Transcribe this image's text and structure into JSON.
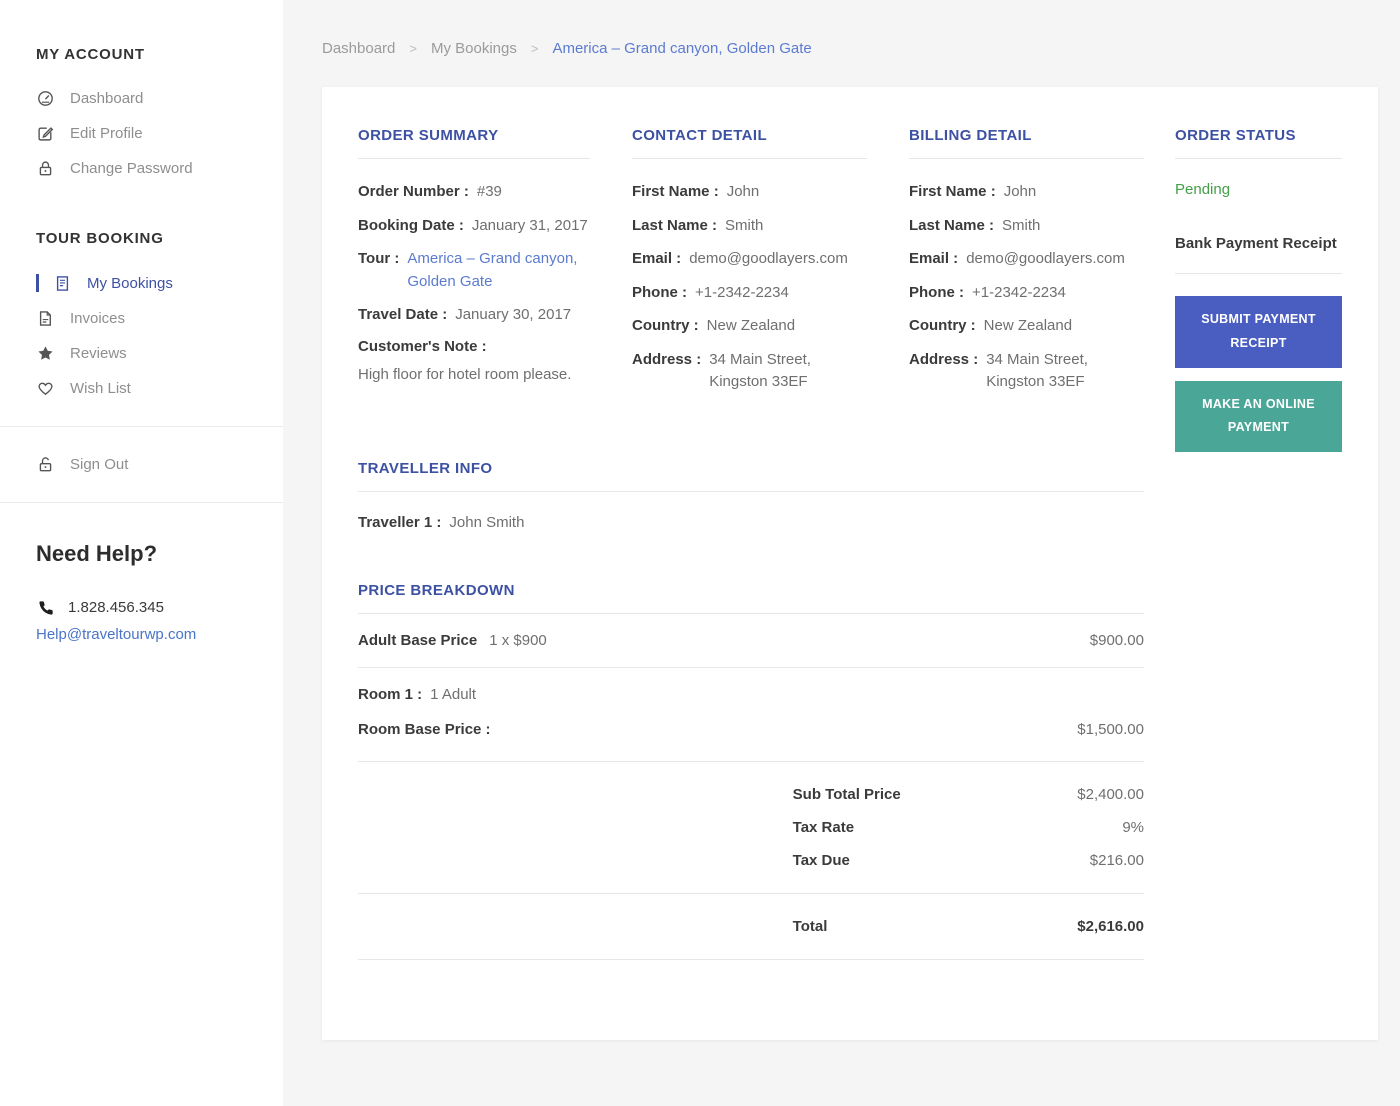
{
  "colors": {
    "heading_blue": "#3d51a3",
    "link_blue": "#5b7bd0",
    "pending_green": "#43a047",
    "button_primary": "#4a5ec2",
    "button_secondary": "#4aa696"
  },
  "sidebar": {
    "sections": [
      {
        "title": "MY ACCOUNT",
        "items": [
          {
            "label": "Dashboard",
            "icon": "dashboard-icon"
          },
          {
            "label": "Edit Profile",
            "icon": "edit-icon"
          },
          {
            "label": "Change Password",
            "icon": "lock-icon"
          }
        ]
      },
      {
        "title": "TOUR BOOKING",
        "items": [
          {
            "label": "My Bookings",
            "icon": "bookings-icon",
            "active": true
          },
          {
            "label": "Invoices",
            "icon": "invoice-icon"
          },
          {
            "label": "Reviews",
            "icon": "star-icon"
          },
          {
            "label": "Wish List",
            "icon": "heart-icon"
          }
        ]
      }
    ],
    "sign_out": {
      "label": "Sign Out",
      "icon": "unlock-icon"
    },
    "help": {
      "title": "Need Help?",
      "phone": "1.828.456.345",
      "email": "Help@traveltourwp.com"
    }
  },
  "breadcrumb": {
    "items": [
      "Dashboard",
      "My Bookings",
      "America – Grand canyon, Golden Gate"
    ],
    "separator": ">"
  },
  "order_summary": {
    "title": "ORDER SUMMARY",
    "rows": [
      {
        "label": "Order Number :",
        "value": "#39"
      },
      {
        "label": "Booking Date :",
        "value": "January 31, 2017"
      },
      {
        "label": "Tour :",
        "value": "America – Grand canyon, Golden Gate"
      },
      {
        "label": "Travel Date :",
        "value": "January 30, 2017"
      }
    ],
    "note_label": "Customer's Note :",
    "note": "High floor for hotel room please."
  },
  "contact_detail": {
    "title": "CONTACT DETAIL",
    "rows": [
      {
        "label": "First Name :",
        "value": "John"
      },
      {
        "label": "Last Name :",
        "value": "Smith"
      },
      {
        "label": "Email :",
        "value": "demo@goodlayers.com"
      },
      {
        "label": "Phone :",
        "value": "+1-2342-2234"
      },
      {
        "label": "Country :",
        "value": "New Zealand"
      },
      {
        "label": "Address :",
        "value": "34 Main Street, Kingston 33EF"
      }
    ]
  },
  "billing_detail": {
    "title": "BILLING DETAIL",
    "rows": [
      {
        "label": "First Name :",
        "value": "John"
      },
      {
        "label": "Last Name :",
        "value": "Smith"
      },
      {
        "label": "Email :",
        "value": "demo@goodlayers.com"
      },
      {
        "label": "Phone :",
        "value": "+1-2342-2234"
      },
      {
        "label": "Country :",
        "value": "New Zealand"
      },
      {
        "label": "Address :",
        "value": "34 Main Street, Kingston 33EF"
      }
    ]
  },
  "order_status": {
    "title": "ORDER STATUS",
    "status": "Pending",
    "receipt_label": "Bank Payment Receipt",
    "buttons": [
      {
        "label": "SUBMIT PAYMENT RECEIPT"
      },
      {
        "label": "MAKE AN ONLINE PAYMENT"
      }
    ]
  },
  "traveller_info": {
    "title": "TRAVELLER INFO",
    "rows": [
      {
        "label": "Traveller 1 :",
        "value": "John Smith"
      }
    ]
  },
  "price_breakdown": {
    "title": "PRICE BREAKDOWN",
    "items": [
      {
        "label": "Adult Base Price",
        "detail": "1 x $900",
        "amount": "$900.00"
      }
    ],
    "room": {
      "label": "Room 1 :",
      "value": "1 Adult",
      "price_label": "Room Base Price :",
      "amount": "$1,500.00"
    },
    "totals": [
      {
        "label": "Sub Total Price",
        "value": "$2,400.00"
      },
      {
        "label": "Tax Rate",
        "value": "9%"
      },
      {
        "label": "Tax Due",
        "value": "$216.00"
      }
    ],
    "total": {
      "label": "Total",
      "value": "$2,616.00"
    }
  }
}
